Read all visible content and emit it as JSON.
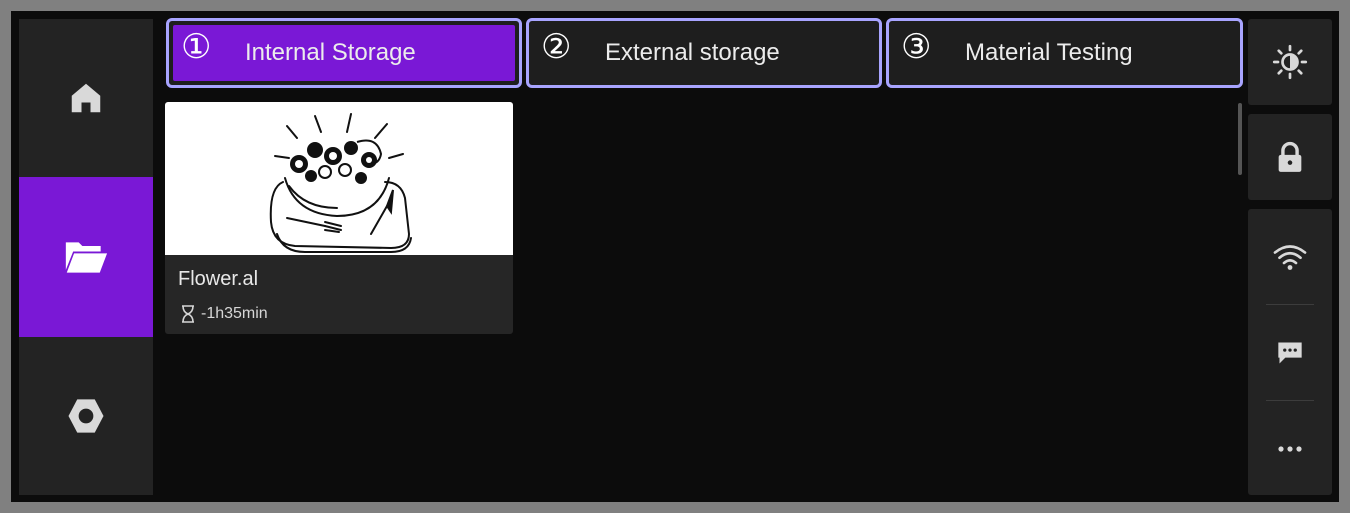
{
  "nav": {
    "items": [
      {
        "name": "home",
        "icon": "home-icon"
      },
      {
        "name": "files",
        "icon": "folder-open-icon",
        "active": true
      },
      {
        "name": "settings",
        "icon": "hexagon-nut-icon"
      }
    ],
    "active_color": "#7a18d6"
  },
  "tabs": [
    {
      "number": "①",
      "label": "Internal Storage",
      "active": true
    },
    {
      "number": "②",
      "label": "External storage",
      "active": false
    },
    {
      "number": "③",
      "label": "Material Testing",
      "active": false
    }
  ],
  "files": [
    {
      "name": "Flower.al",
      "duration": "-1h35min",
      "thumbnail": "salad-bowl-illustration"
    }
  ],
  "right_panel": {
    "buttons": [
      "brightness-icon",
      "lock-icon",
      "wifi-icon",
      "message-icon",
      "more-icon"
    ]
  },
  "colors": {
    "accent": "#7a18d6",
    "tab_outline": "#a8a4ff",
    "background": "#0c0c0c",
    "panel": "#232323"
  }
}
